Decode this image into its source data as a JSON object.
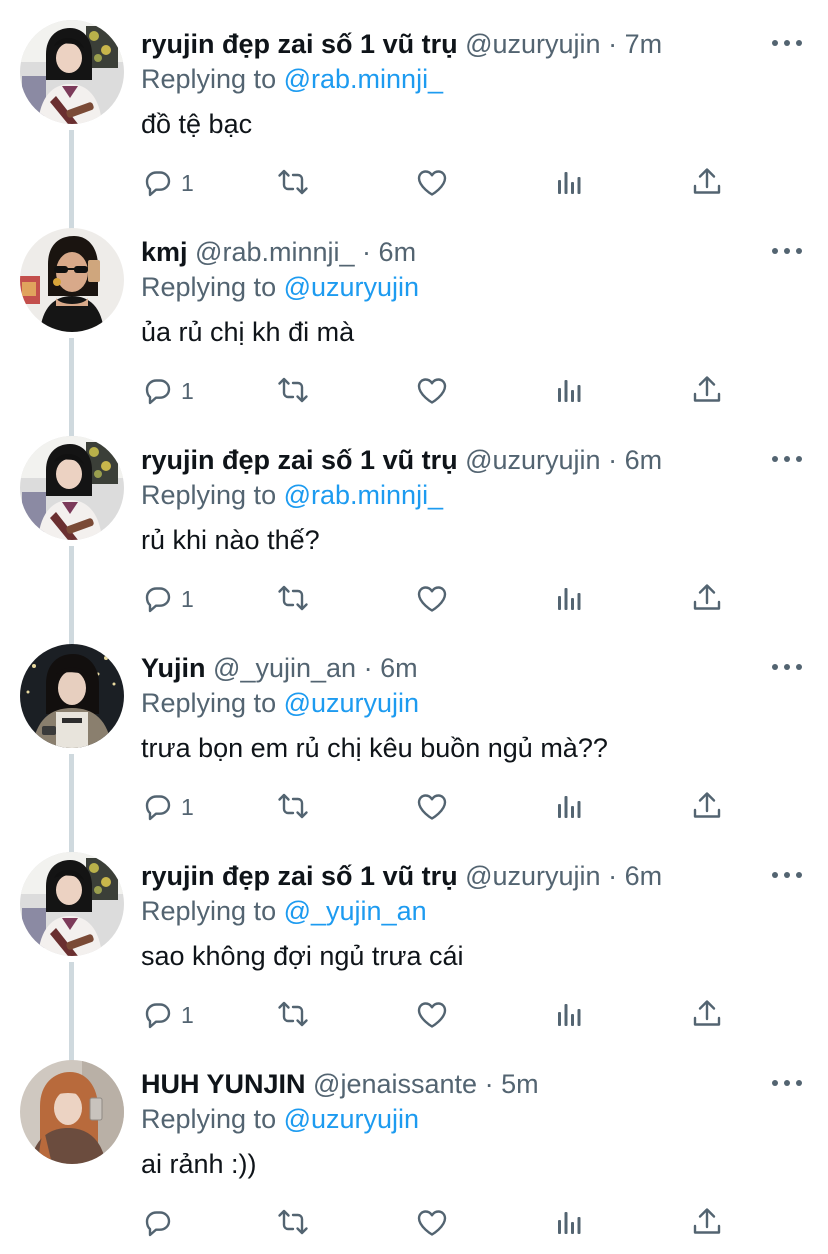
{
  "colors": {
    "accent": "#1d9bf0",
    "secondary_text": "#536471",
    "primary_text": "#0f1419",
    "thread_line": "#cfd9de"
  },
  "icons": {
    "reply": "reply-icon",
    "retweet": "retweet-icon",
    "like": "heart-icon",
    "views": "analytics-icon",
    "share": "share-icon",
    "more": "more-icon"
  },
  "tweets": [
    {
      "display_name": "ryujin đẹp zai số 1 vũ trụ",
      "handle": "@uzuryujin",
      "separator": "·",
      "time": "7m",
      "replying_prefix": "Replying to",
      "replying_to": "@rab.minnji_",
      "text": "đồ tệ bạc",
      "reply_count": "1",
      "avatar": "ryujin"
    },
    {
      "display_name": "kmj",
      "handle": "@rab.minnji_",
      "separator": "·",
      "time": "6m",
      "replying_prefix": "Replying to",
      "replying_to": "@uzuryujin",
      "text": "ủa rủ chị kh đi mà",
      "reply_count": "1",
      "avatar": "kmj"
    },
    {
      "display_name": "ryujin đẹp zai số 1 vũ trụ",
      "handle": "@uzuryujin",
      "separator": "·",
      "time": "6m",
      "replying_prefix": "Replying to",
      "replying_to": "@rab.minnji_",
      "text": "rủ khi nào thế?",
      "reply_count": "1",
      "avatar": "ryujin"
    },
    {
      "display_name": "Yujin",
      "handle": "@_yujin_an",
      "separator": "·",
      "time": "6m",
      "replying_prefix": "Replying to",
      "replying_to": "@uzuryujin",
      "text": "trưa bọn em rủ chị kêu buồn ngủ mà??",
      "reply_count": "1",
      "avatar": "yujin"
    },
    {
      "display_name": "ryujin đẹp zai số 1 vũ trụ",
      "handle": "@uzuryujin",
      "separator": "·",
      "time": "6m",
      "replying_prefix": "Replying to",
      "replying_to": "@_yujin_an",
      "text": "sao không đợi ngủ trưa cái",
      "reply_count": "1",
      "avatar": "ryujin"
    },
    {
      "display_name": "HUH YUNJIN",
      "handle": "@jenaissante",
      "separator": "·",
      "time": "5m",
      "replying_prefix": "Replying to",
      "replying_to": "@uzuryujin",
      "text": "ai rảnh :))",
      "reply_count": "",
      "avatar": "yunjin"
    }
  ]
}
